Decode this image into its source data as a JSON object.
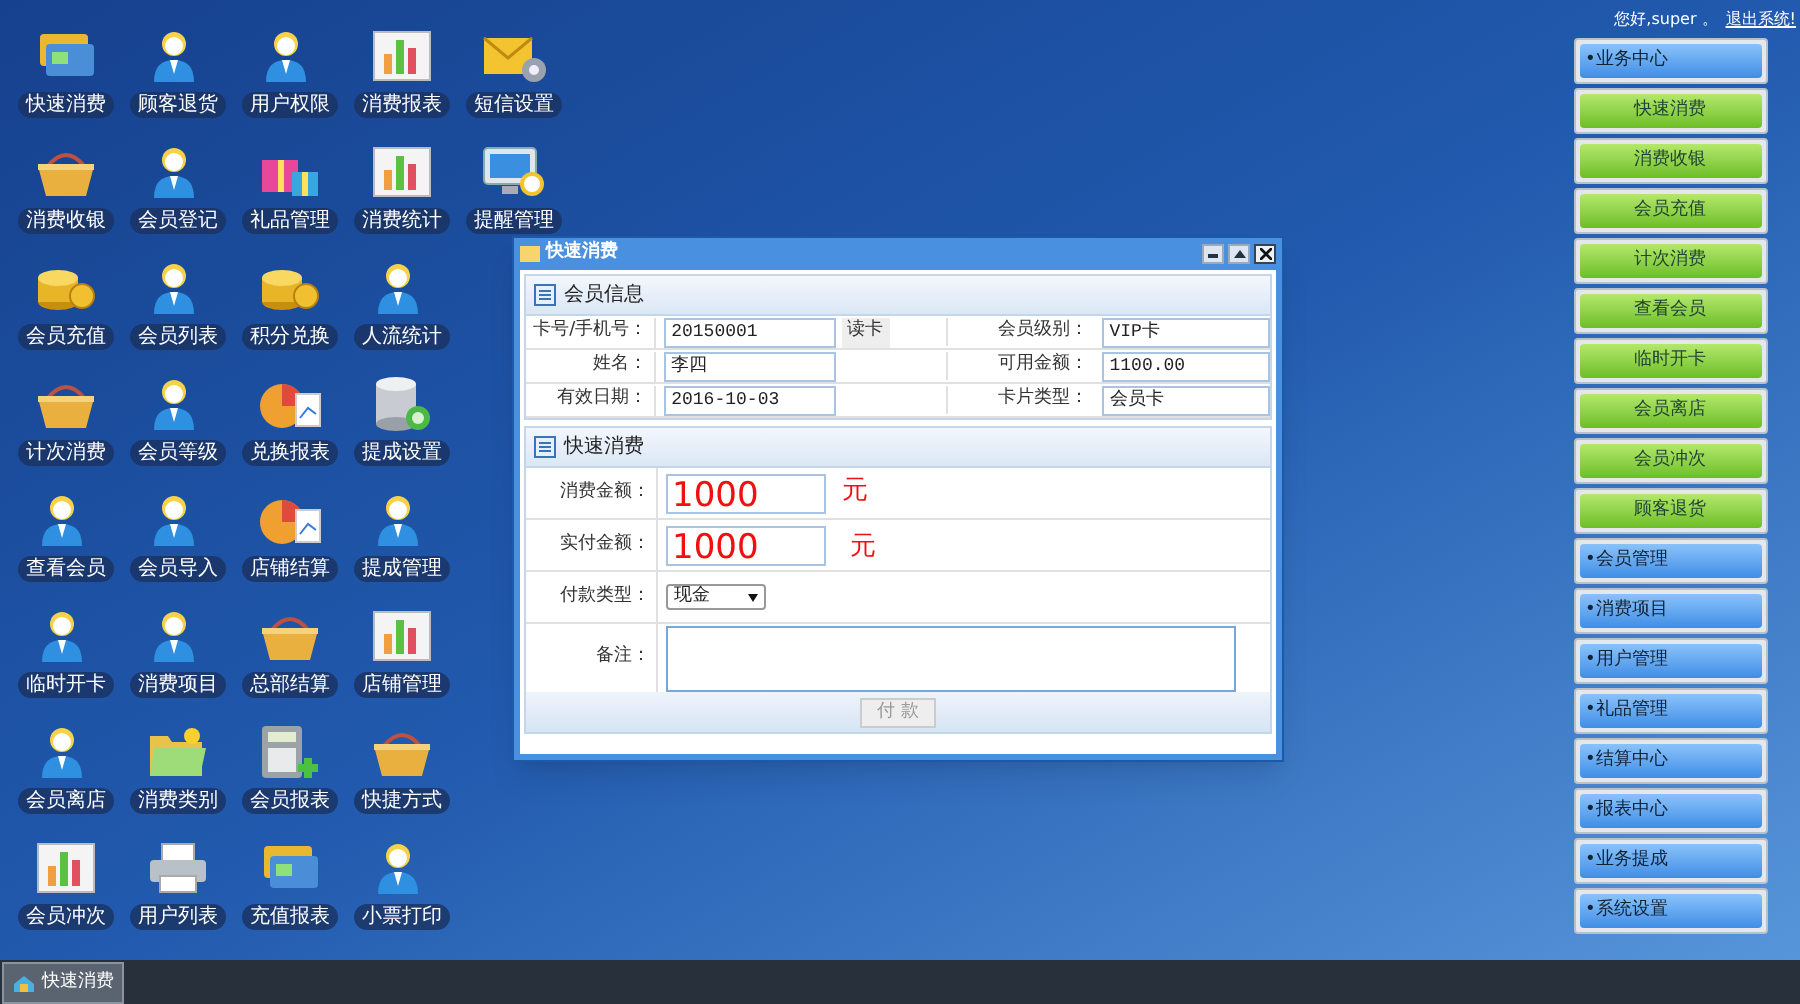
{
  "user_bar": {
    "greeting": "您好,super 。",
    "logout": "退出系统!"
  },
  "shortcut_rows": [
    [
      "快速消费",
      "顾客退货",
      "用户权限",
      "消费报表",
      "短信设置"
    ],
    [
      "消费收银",
      "会员登记",
      "礼品管理",
      "消费统计",
      "提醒管理"
    ],
    [
      "会员充值",
      "会员列表",
      "积分兑换",
      "人流统计"
    ],
    [
      "计次消费",
      "会员等级",
      "兑换报表",
      "提成设置"
    ],
    [
      "查看会员",
      "会员导入",
      "店铺结算",
      "提成管理"
    ],
    [
      "临时开卡",
      "消费项目",
      "总部结算",
      "店铺管理"
    ],
    [
      "会员离店",
      "消费类别",
      "会员报表",
      "快捷方式"
    ],
    [
      "会员冲次",
      "用户列表",
      "充值报表",
      "小票打印"
    ]
  ],
  "dialog": {
    "title": "快速消费",
    "member_section": {
      "title": "会员信息",
      "rows": [
        {
          "label": "卡号/手机号：",
          "value": "20150001",
          "button": "读卡",
          "label_2": "会员级别：",
          "value_2": "VIP卡"
        },
        {
          "label": "姓名：",
          "value": "李四",
          "label_2": "可用金额：",
          "value_2": "1100.00"
        },
        {
          "label": "有效日期：",
          "value": "2016-10-03",
          "label_2": "卡片类型：",
          "value_2": "会员卡"
        }
      ]
    },
    "consume_section": {
      "title": "快速消费",
      "amount": {
        "label": "消费金额：",
        "value": "1000",
        "unit": "元"
      },
      "paid": {
        "label": "实付金额：",
        "value": "1000",
        "unit": "元"
      },
      "payment_type": {
        "label": "付款类型：",
        "value": "现金"
      },
      "note": {
        "label": "备注："
      },
      "submit": {
        "label": "付 款",
        "disabled": true
      }
    }
  },
  "side_menu": [
    {
      "label": "•业务中心",
      "kind": "group"
    },
    {
      "label": "快速消费",
      "kind": "item"
    },
    {
      "label": "消费收银",
      "kind": "item"
    },
    {
      "label": "会员充值",
      "kind": "item"
    },
    {
      "label": "计次消费",
      "kind": "item"
    },
    {
      "label": "查看会员",
      "kind": "item"
    },
    {
      "label": "临时开卡",
      "kind": "item"
    },
    {
      "label": "会员离店",
      "kind": "item"
    },
    {
      "label": "会员冲次",
      "kind": "item"
    },
    {
      "label": "顾客退货",
      "kind": "item"
    },
    {
      "label": "•会员管理",
      "kind": "group"
    },
    {
      "label": "•消费项目",
      "kind": "group"
    },
    {
      "label": "•用户管理",
      "kind": "group"
    },
    {
      "label": "•礼品管理",
      "kind": "group"
    },
    {
      "label": "•结算中心",
      "kind": "group"
    },
    {
      "label": "•报表中心",
      "kind": "group"
    },
    {
      "label": "•业务提成",
      "kind": "group"
    },
    {
      "label": "•系统设置",
      "kind": "group"
    }
  ],
  "taskbar": {
    "items": [
      {
        "label": "快速消费",
        "selected": true
      }
    ]
  }
}
